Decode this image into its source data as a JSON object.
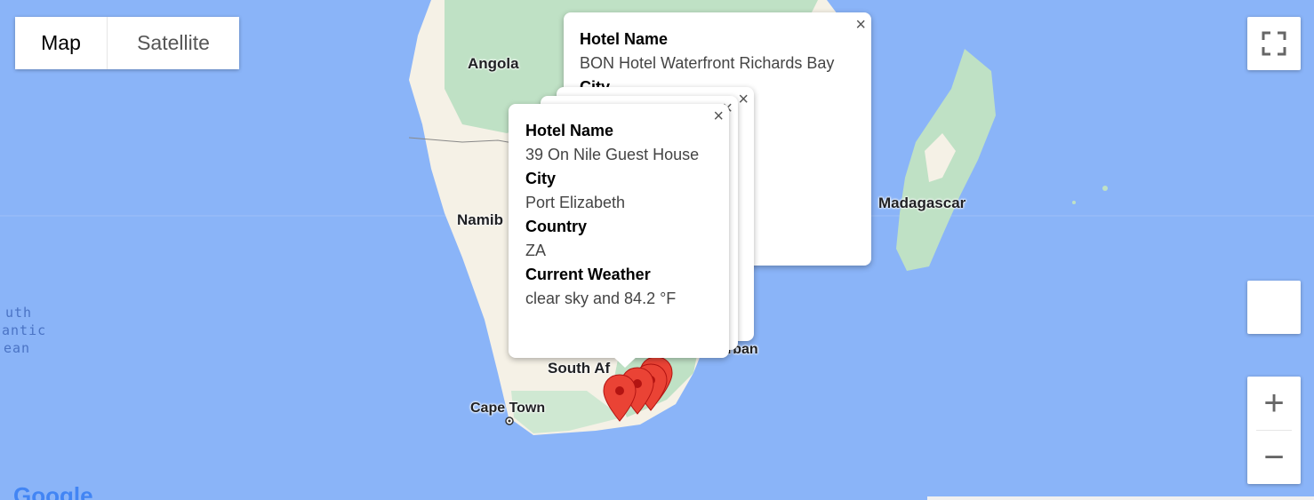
{
  "map_type_control": {
    "map_label": "Map",
    "satellite_label": "Satellite",
    "selected": "Map"
  },
  "labels": {
    "angola": "Angola",
    "namibia": "Namib",
    "south_africa": "South Af",
    "cape_town": "Cape Town",
    "durban": "rban",
    "madagascar": "Madagascar",
    "ocean_1": "uth",
    "ocean_2": "antic",
    "ocean_3": "ean"
  },
  "info_back": {
    "hotel_name_key": "Hotel Name",
    "hotel_name": "BON Hotel Waterfront Richards Bay",
    "city_key": "City"
  },
  "info_front": {
    "hotel_name_key": "Hotel Name",
    "hotel_name": "39 On Nile Guest House",
    "city_key": "City",
    "city": "Port Elizabeth",
    "country_key": "Country",
    "country": "ZA",
    "weather_key": "Current Weather",
    "weather": "clear sky and 84.2 °F"
  },
  "controls": {
    "close_glyph": "×",
    "zoom_in": "+",
    "zoom_out": "−",
    "logo": "Google"
  },
  "colors": {
    "ocean": "#8ab4f8",
    "land": "#f5f1e6",
    "forest": "#bfe1c5",
    "marker": "#ea4335"
  }
}
